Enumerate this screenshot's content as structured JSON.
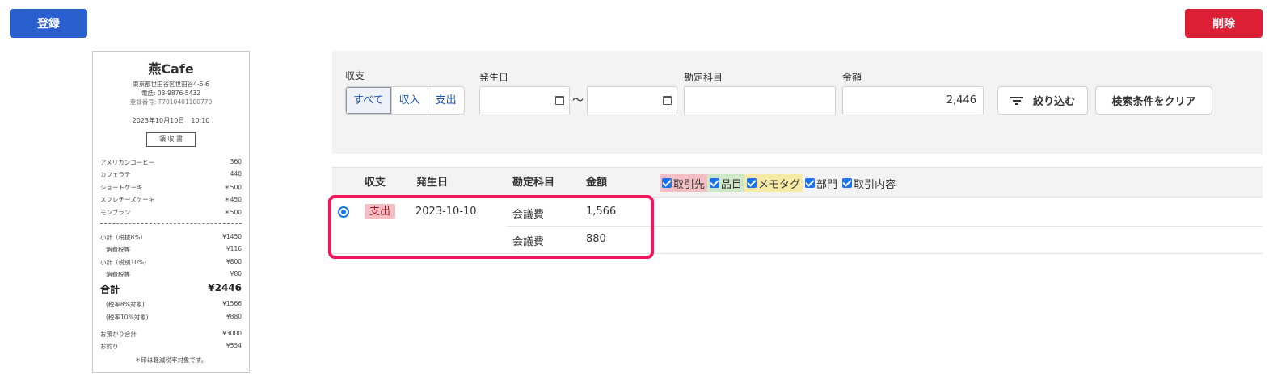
{
  "toolbar": {
    "register_label": "登録",
    "delete_label": "削除"
  },
  "receipt": {
    "store": "燕Cafe",
    "address": "東京都世田谷区世田谷4-5-6",
    "phone": "電話: 03-9876-5432",
    "reg_no": "登録番号: T7010401100770",
    "datetime": "2023年10月10日　10:10",
    "doc_title": "領 収 書",
    "items": [
      {
        "name": "アメリカンコーヒー",
        "price": "360"
      },
      {
        "name": "カフェラテ",
        "price": "440"
      },
      {
        "name": "ショートケーキ",
        "price": "＊500"
      },
      {
        "name": "スフレチーズケーキ",
        "price": "＊450"
      },
      {
        "name": "モンブラン",
        "price": "＊500"
      }
    ],
    "summary": [
      {
        "name": "小計（税抜8%）",
        "value": "¥1450"
      },
      {
        "name": "消費税等",
        "value": "¥116"
      },
      {
        "name": "小計（税別10%）",
        "value": "¥800"
      },
      {
        "name": "消費税等",
        "value": "¥80"
      }
    ],
    "total_label": "合計",
    "total_value": "¥2446",
    "tax_breakdown": [
      {
        "name": "(税率8%対象)",
        "value": "¥1566"
      },
      {
        "name": "(税率10%対象)",
        "value": "¥880"
      }
    ],
    "payment": [
      {
        "name": "お預かり合計",
        "value": "¥3000"
      },
      {
        "name": "お釣り",
        "value": "¥554"
      }
    ],
    "note": "＊印は軽減税率対象です。"
  },
  "filter": {
    "type_label": "収支",
    "type_options": [
      "すべて",
      "収入",
      "支出"
    ],
    "date_label": "発生日",
    "date_sep": "～",
    "account_label": "勘定科目",
    "amount_label": "金額",
    "amount_value": "2,446",
    "apply_label": "絞り込む",
    "clear_label": "検索条件をクリア"
  },
  "table": {
    "headers": [
      "収支",
      "発生日",
      "勘定科目",
      "金額"
    ],
    "toggles": [
      {
        "label": "取引先",
        "color": "#f4bfc4"
      },
      {
        "label": "品目",
        "color": "#cfe8c8"
      },
      {
        "label": "メモタグ",
        "color": "#f7eaa6"
      },
      {
        "label": "部門",
        "color": ""
      },
      {
        "label": "取引内容",
        "color": ""
      }
    ],
    "row": {
      "type": "支出",
      "date": "2023-10-10",
      "lines": [
        {
          "account": "会議費",
          "amount": "1,566"
        },
        {
          "account": "会議費",
          "amount": "880"
        }
      ]
    }
  }
}
